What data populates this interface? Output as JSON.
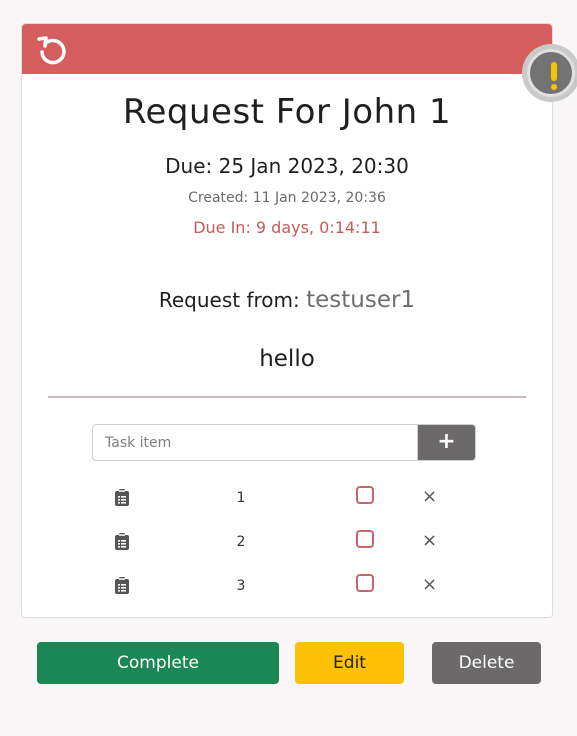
{
  "header": {
    "undo_icon": "undo-icon",
    "alert_icon": "exclamation-icon",
    "accent_color": "#d55d5e"
  },
  "request": {
    "title": "Request For John 1",
    "due": "Due: 25 Jan 2023, 20:30",
    "created": "Created: 11 Jan 2023, 20:36",
    "due_in": "Due In: 9 days, 0:14:11",
    "from_label": "Request from: ",
    "from_user": "testuser1",
    "message": "hello"
  },
  "task_form": {
    "placeholder": "Task item",
    "add_label": "+"
  },
  "tasks": [
    {
      "text": "1",
      "checked": false
    },
    {
      "text": "2",
      "checked": false
    },
    {
      "text": "3",
      "checked": false
    }
  ],
  "task_delete_label": "×",
  "actions": {
    "complete_label": "Complete",
    "edit_label": "Edit",
    "delete_label": "Delete"
  }
}
